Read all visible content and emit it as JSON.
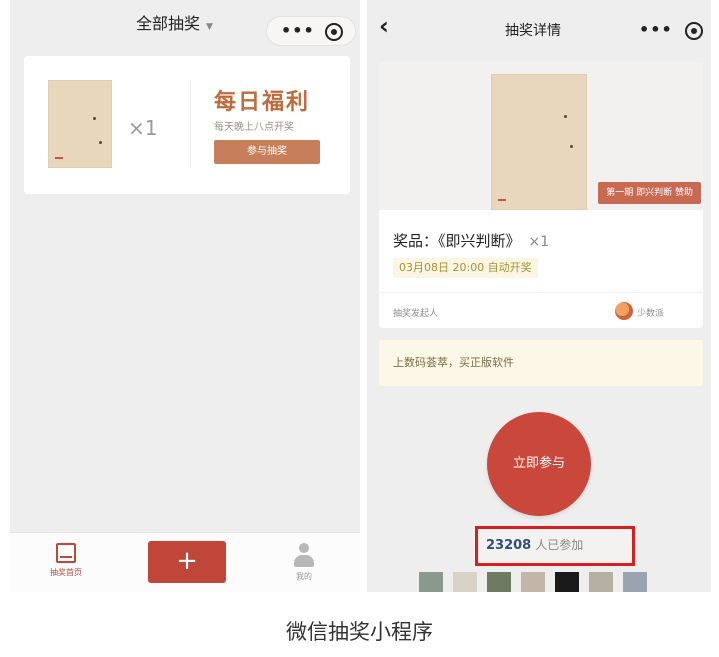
{
  "left_screen": {
    "nav": {
      "title": "全部抽奖",
      "caret": "▼",
      "menu_icon": "more-dots-icon",
      "close_icon": "record-icon"
    },
    "daily_card": {
      "quantity": "×1",
      "title": "每日福利",
      "subtitle": "每天晚上八点开奖",
      "button": "参与抽奖"
    },
    "tabbar": {
      "home_label": "抽奖首页",
      "add_label": "+",
      "mine_label": "我的"
    }
  },
  "right_screen": {
    "nav": {
      "back": "‹",
      "title": "抽奖详情",
      "menu_icon": "more-dots-icon",
      "close_icon": "record-icon"
    },
    "prize": {
      "tag": "第一期 即兴判断 赞助",
      "name": "奖品：《即兴判断》",
      "qty": "×1",
      "draw_time": "03月08日 20:00 自动开奖"
    },
    "sponsor": {
      "label": "抽奖发起人",
      "name": "少数派"
    },
    "notice": "上数码荟萃，买正版软件",
    "join_button": "立即参与",
    "joined": {
      "count": "23208",
      "label": "人已参加"
    },
    "avatar_colors": [
      "#8a9890",
      "#d8d3c6",
      "#6e7a62",
      "#c2b6a8",
      "#1a1a1a",
      "#b4b0a2",
      "#9aa4b0"
    ]
  },
  "caption": "微信抽奖小程序",
  "colors": {
    "accent_red": "#c0463a",
    "highlight_box": "#d81f1f",
    "daily_title": "#c06a3e"
  }
}
